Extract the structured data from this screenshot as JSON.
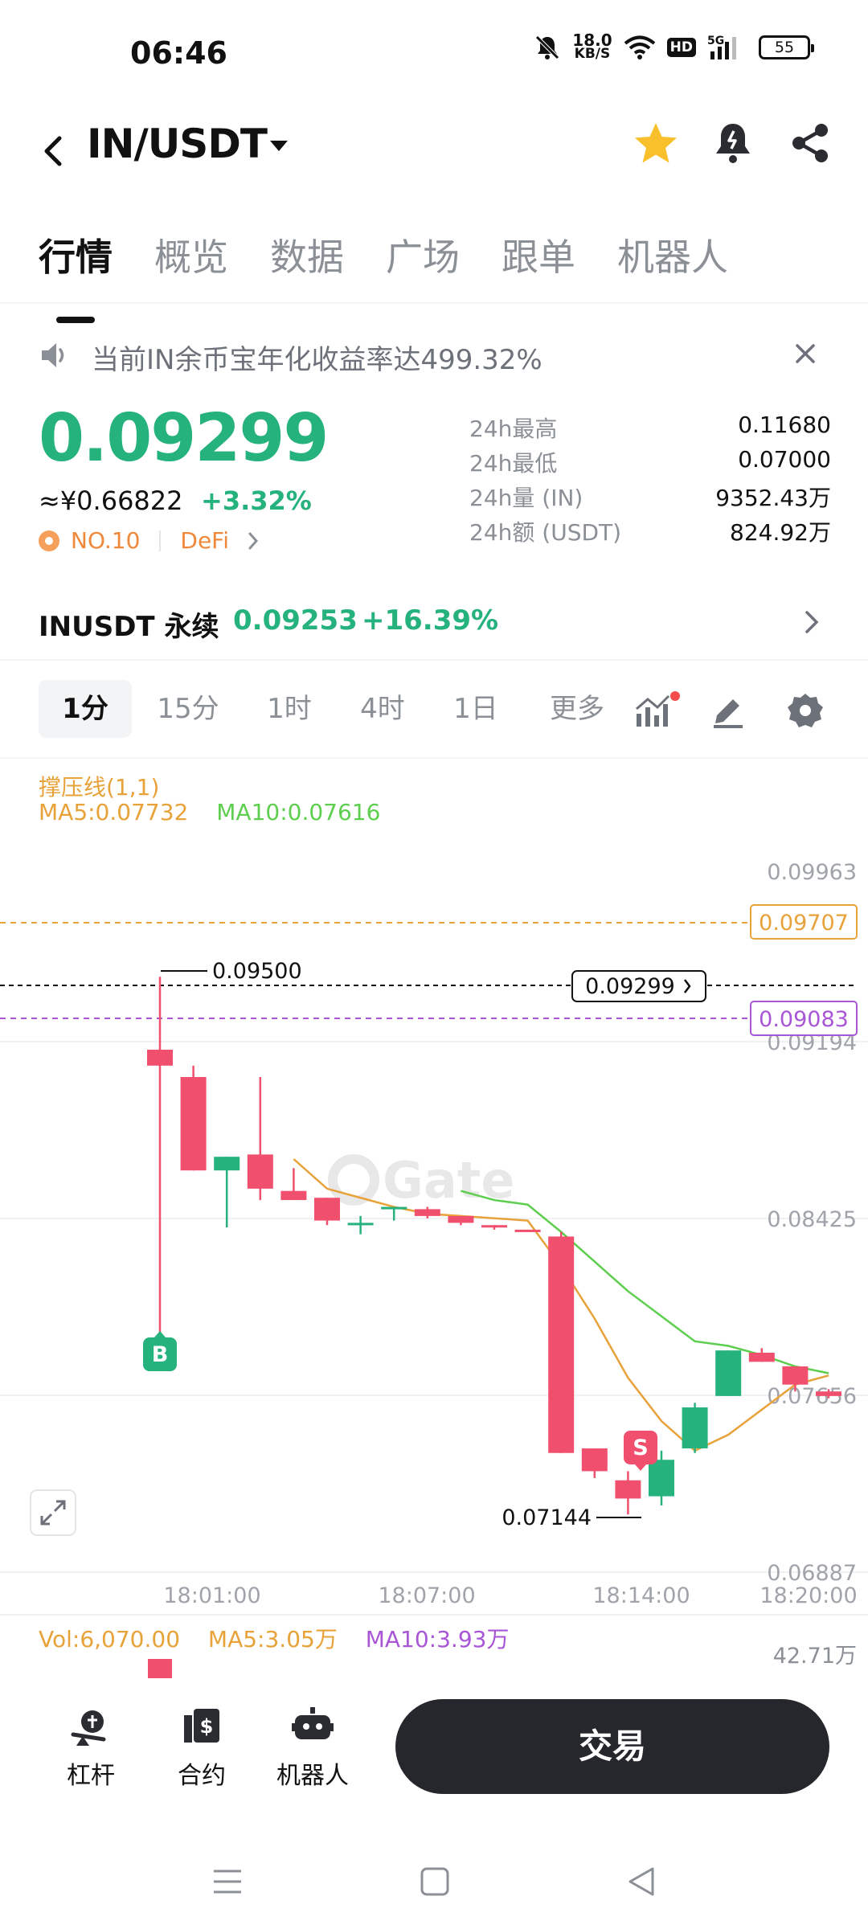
{
  "status": {
    "time": "06:46",
    "net_speed_value": "18.0",
    "net_speed_unit": "KB/S",
    "hd": "HD",
    "signal": "5G",
    "battery": "55"
  },
  "header": {
    "pair": "IN/USDT"
  },
  "tabs": [
    "行情",
    "概览",
    "数据",
    "广场",
    "跟单",
    "机器人"
  ],
  "notice": {
    "text": "当前IN余币宝年化收益率达499.32%"
  },
  "price": {
    "last": "0.09299",
    "cny": "≈¥0.66822",
    "change": "+3.32%",
    "rank": "NO.10",
    "tag": "DeFi"
  },
  "stats": [
    {
      "label": "24h最高",
      "value": "0.11680"
    },
    {
      "label": "24h最低",
      "value": "0.07000"
    },
    {
      "label": "24h量 (IN)",
      "value": "9352.43万"
    },
    {
      "label": "24h额 (USDT)",
      "value": "824.92万"
    }
  ],
  "perpetual": {
    "name": "INUSDT 永续",
    "price": "0.09253",
    "change": "+16.39%"
  },
  "intervals": [
    "1分",
    "15分",
    "1时",
    "4时",
    "1日",
    "更多"
  ],
  "chart_legend": {
    "sr_line": "撑压线(1,1)",
    "ma5": "MA5:0.07732",
    "ma10": "MA10:0.07616"
  },
  "chart_data": {
    "type": "candlestick",
    "watermark": "Gate",
    "y_ticks": [
      "0.09963",
      "0.09194",
      "0.08425",
      "0.07656",
      "0.06887"
    ],
    "ylim": [
      0.06887,
      0.09963
    ],
    "x_ticks": [
      "18:01:00",
      "18:07:00",
      "18:14:00",
      "18:20:00"
    ],
    "resistance_line": "0.09707",
    "support_line": "0.09083",
    "current_price_tag": "0.09299",
    "high_marker": "0.09500",
    "low_marker": "0.07144",
    "buy_marker": "B",
    "sell_marker": "S",
    "candles": [
      {
        "o": 0.0918,
        "c": 0.0911,
        "h": 0.095,
        "l": 0.078
      },
      {
        "o": 0.0906,
        "c": 0.0865,
        "h": 0.0911,
        "l": 0.0865
      },
      {
        "o": 0.0865,
        "c": 0.0871,
        "h": 0.0871,
        "l": 0.084
      },
      {
        "o": 0.0872,
        "c": 0.0857,
        "h": 0.0906,
        "l": 0.0852
      },
      {
        "o": 0.0856,
        "c": 0.0852,
        "h": 0.0866,
        "l": 0.0852
      },
      {
        "o": 0.0853,
        "c": 0.0843,
        "h": 0.0853,
        "l": 0.0841
      },
      {
        "o": 0.0841,
        "c": 0.0842,
        "h": 0.0845,
        "l": 0.0837
      },
      {
        "o": 0.0848,
        "c": 0.0849,
        "h": 0.0849,
        "l": 0.0843
      },
      {
        "o": 0.0848,
        "c": 0.0845,
        "h": 0.0849,
        "l": 0.0844
      },
      {
        "o": 0.0845,
        "c": 0.0842,
        "h": 0.0845,
        "l": 0.0841
      },
      {
        "o": 0.0841,
        "c": 0.084,
        "h": 0.0841,
        "l": 0.0839
      },
      {
        "o": 0.0839,
        "c": 0.0838,
        "h": 0.0839,
        "l": 0.0838
      },
      {
        "o": 0.0836,
        "c": 0.0741,
        "h": 0.0838,
        "l": 0.0741
      },
      {
        "o": 0.0743,
        "c": 0.0733,
        "h": 0.0743,
        "l": 0.073
      },
      {
        "o": 0.0729,
        "c": 0.0721,
        "h": 0.0733,
        "l": 0.0714
      },
      {
        "o": 0.0722,
        "c": 0.0738,
        "h": 0.0742,
        "l": 0.0718
      },
      {
        "o": 0.0743,
        "c": 0.0761,
        "h": 0.0763,
        "l": 0.0741
      },
      {
        "o": 0.0766,
        "c": 0.0786,
        "h": 0.0786,
        "l": 0.0766
      },
      {
        "o": 0.0785,
        "c": 0.0781,
        "h": 0.0787,
        "l": 0.0781
      },
      {
        "o": 0.0779,
        "c": 0.0771,
        "h": 0.0779,
        "l": 0.0768
      },
      {
        "o": 0.0768,
        "c": 0.0766,
        "h": 0.0769,
        "l": 0.0765
      }
    ],
    "ma5": [
      null,
      null,
      null,
      null,
      0.087,
      0.0857,
      0.0853,
      0.0849,
      0.0846,
      0.0845,
      0.0844,
      0.0843,
      0.0823,
      0.08,
      0.0774,
      0.0755,
      0.0742,
      0.0749,
      0.076,
      0.0771,
      0.0775
    ],
    "ma10": [
      null,
      null,
      null,
      null,
      null,
      null,
      null,
      null,
      null,
      0.0856,
      0.0852,
      0.085,
      0.0838,
      0.0825,
      0.0812,
      0.0801,
      0.079,
      0.0788,
      0.0784,
      0.0779,
      0.0776
    ],
    "colors": {
      "up": "#25b27c",
      "down": "#f0506e",
      "ma5": "#e8a23a",
      "ma10": "#5dce4d"
    }
  },
  "volume": {
    "vol": "Vol:6,070.00",
    "ma5": "MA5:3.05万",
    "ma10": "MA10:3.93万",
    "max": "42.71万"
  },
  "bottom_nav": {
    "leverage": "杠杆",
    "contract": "合约",
    "robot": "机器人",
    "trade": "交易"
  }
}
